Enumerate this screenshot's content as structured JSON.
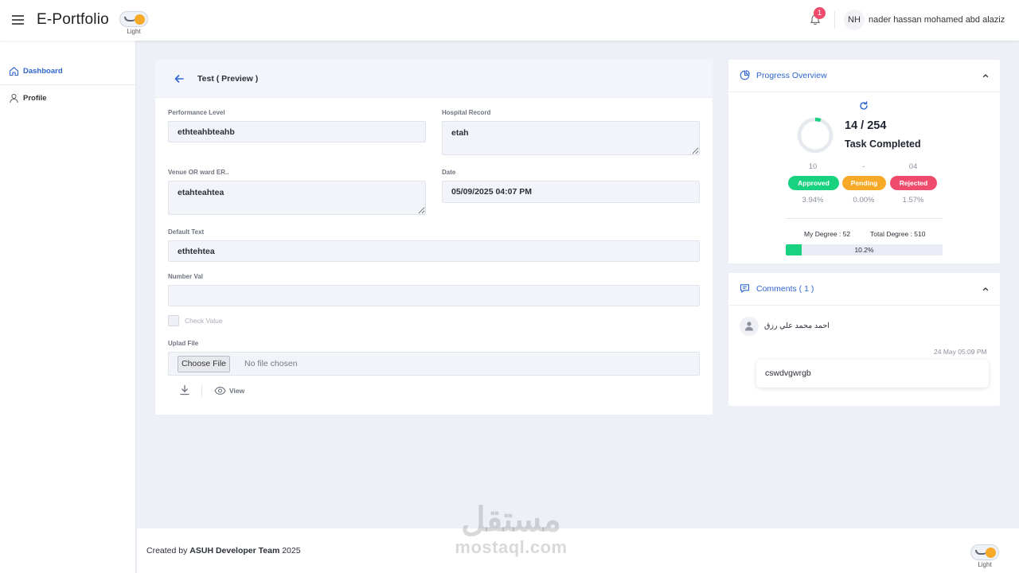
{
  "header": {
    "brand": "E-Portfolio",
    "theme_label": "Light",
    "notification_count": "1",
    "user_initials": "NH",
    "user_name": "nader hassan mohamed abd alaziz"
  },
  "sidebar": {
    "items": [
      {
        "label": "Dashboard",
        "icon": "home-icon",
        "active": true
      },
      {
        "label": "Profile",
        "icon": "user-icon",
        "active": false
      }
    ]
  },
  "form": {
    "title": "Test ( Preview )",
    "fields": {
      "performance_level": {
        "label": "Performance Level",
        "value": "ethteahbteahb"
      },
      "hospital_record": {
        "label": "Hospital Record",
        "value": "etah"
      },
      "venue": {
        "label": "Venue OR ward ER..",
        "value": "etahteahtea"
      },
      "date": {
        "label": "Date",
        "value": "05/09/2025 04:07 PM"
      },
      "default_text": {
        "label": "Default Text",
        "value": "ethtehtea"
      },
      "number_val": {
        "label": "Number Val",
        "value": ""
      },
      "check_value": {
        "label": "Check Value",
        "checked": false
      },
      "upload": {
        "label": "Uplad File",
        "button": "Choose File",
        "status": "No file chosen"
      }
    },
    "view_label": "View"
  },
  "progress": {
    "title": "Progress Overview",
    "completed": "14 / 254",
    "completed_label": "Task Completed",
    "completed_fraction": 0.0551,
    "statuses": [
      {
        "label": "Approved",
        "count": "10",
        "percent": "3.94%",
        "color": "#19d27f"
      },
      {
        "label": "Pending",
        "count": "-",
        "percent": "0.00%",
        "color": "#f7a928"
      },
      {
        "label": "Rejected",
        "count": "04",
        "percent": "1.57%",
        "color": "#ef4b6c"
      }
    ],
    "my_degree": "My Degree : 52",
    "total_degree": "Total Degree : 510",
    "degree_percent": "10.2%",
    "degree_fraction": 0.102
  },
  "comments": {
    "title": "Comments ( 1 )",
    "items": [
      {
        "author": "احمد محمد علي رزق",
        "time": "24 May 05:09 PM",
        "text": "cswdvgwrgb"
      }
    ]
  },
  "footer": {
    "prefix": "Created by ",
    "team": "ASUH Developer Team",
    "year": " 2025",
    "theme_label": "Light"
  },
  "watermark": {
    "arabic": "مستقل",
    "latin": "mostaql.com"
  },
  "colors": {
    "accent": "#2f66d0",
    "approved": "#19d27f",
    "pending": "#f7a928",
    "rejected": "#ef4b6c"
  }
}
